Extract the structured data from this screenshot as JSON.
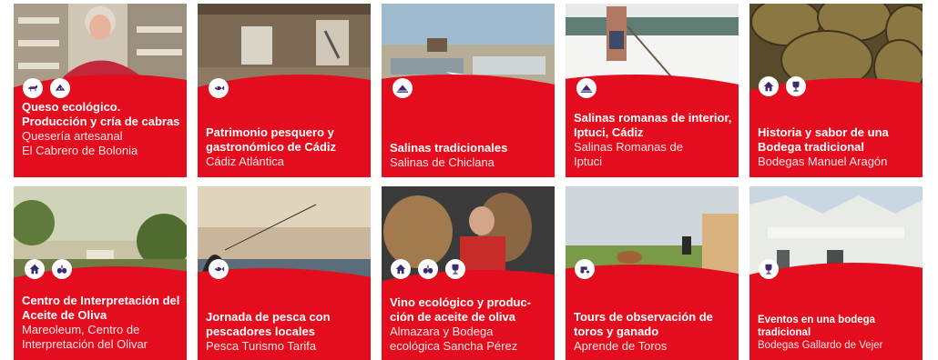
{
  "cards": [
    {
      "title": "Queso ecológico. Producción y cría de cabras",
      "subtitle_1": "Quesería artesanal",
      "subtitle_2": "El Cabrero de Bolonia",
      "icons": [
        "goat-icon",
        "cheese-icon"
      ]
    },
    {
      "title": "Patrimonio pesquero y gastronómico de Cádiz",
      "subtitle_1": "Cádiz Atlántica",
      "subtitle_2": "",
      "icons": [
        "fish-icon"
      ]
    },
    {
      "title": "Salinas tradicionales",
      "subtitle_1": "Salinas de Chiclana",
      "subtitle_2": "",
      "icons": [
        "salt-mound-icon"
      ]
    },
    {
      "title": "Salinas romanas de interior, Iptuci, Cádiz",
      "subtitle_1": "Salinas Romanas de",
      "subtitle_2": "Iptuci",
      "icons": [
        "salt-mound-icon"
      ]
    },
    {
      "title": "Historia y sabor de una Bodega tradicional",
      "subtitle_1": "Bodegas Manuel Aragón",
      "subtitle_2": "",
      "icons": [
        "house-icon",
        "wine-glass-icon"
      ]
    },
    {
      "title": "Centro de Interpretación del Aceite de Oliva",
      "subtitle_1": "Mareoleum, Centro de",
      "subtitle_2": "Interpretación del Olivar",
      "icons": [
        "house-icon",
        "olive-icon"
      ]
    },
    {
      "title": "Jornada de pesca con pescadores locales",
      "subtitle_1": "Pesca Turismo Tarifa",
      "subtitle_2": "",
      "icons": [
        "fish-icon"
      ]
    },
    {
      "title": "Vino ecológico y produc-ción de aceite de oliva",
      "subtitle_1": "Almazara y Bodega",
      "subtitle_2": "ecológica Sancha Pérez",
      "icons": [
        "house-icon",
        "olive-icon",
        "wine-glass-icon"
      ]
    },
    {
      "title": "Tours de observación de toros y ganado",
      "subtitle_1": "Aprende de Toros",
      "subtitle_2": "",
      "icons": [
        "tractor-icon"
      ]
    },
    {
      "title": "Eventos en una bodega tradicional",
      "subtitle_1": "Bodegas Gallardo de Vejer",
      "subtitle_2": "",
      "icons": [
        "wine-glass-icon"
      ]
    }
  ],
  "colors": {
    "accent_red": "#e30d1d",
    "icon_purple": "#3c2a6e",
    "text_white": "#ffffff"
  }
}
